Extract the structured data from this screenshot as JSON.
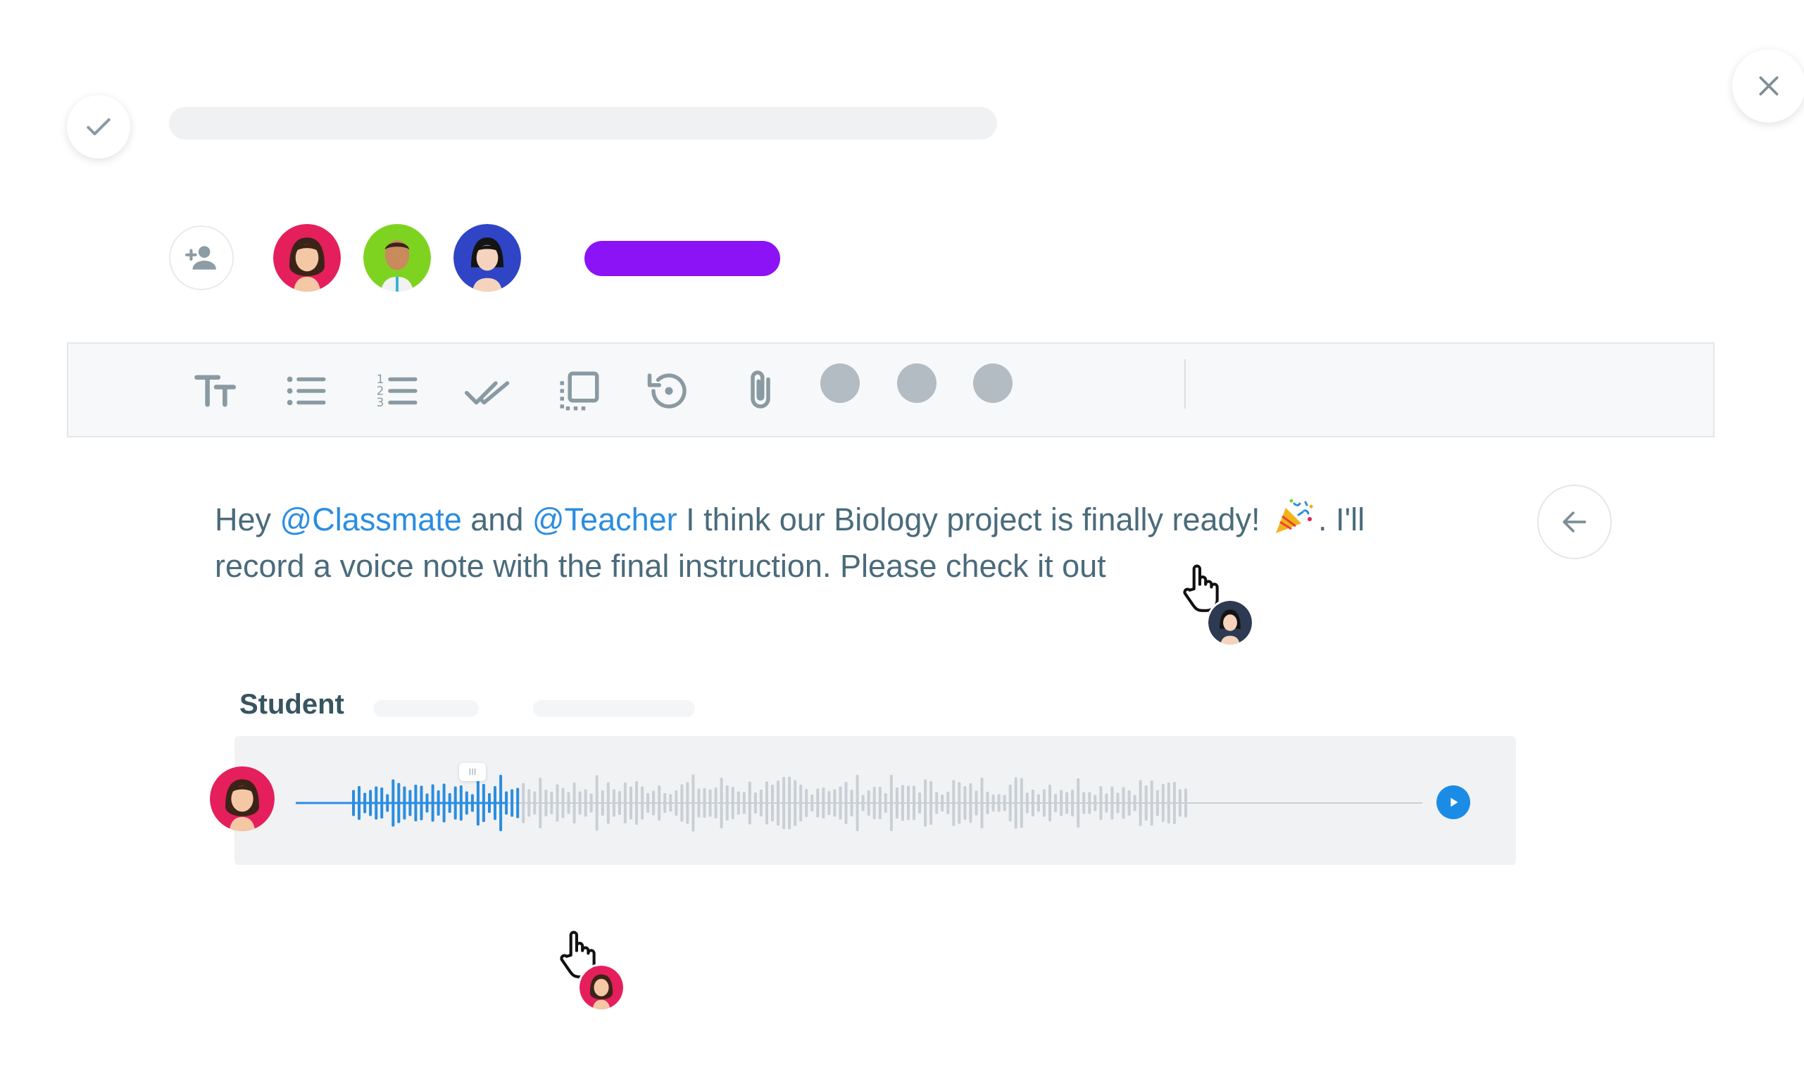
{
  "header": {
    "complete_icon": "check-icon",
    "close_icon": "close-icon"
  },
  "members": {
    "add_icon": "add-person-icon",
    "avatars": [
      "avatar-girl-brown-hair",
      "avatar-boy",
      "avatar-girl-black-hair"
    ]
  },
  "toolbar": {
    "items": [
      "text-size-icon",
      "bullet-list-icon",
      "numbered-list-icon",
      "checklist-icon",
      "copy-icon",
      "history-icon",
      "attachment-icon"
    ],
    "dots": 3
  },
  "message": {
    "part1": "Hey ",
    "mention1": "@Classmate",
    "part2": " and ",
    "mention2": "@Teacher",
    "part3": " I think our Biology project is finally ready! ",
    "emoji": "party-popper-icon",
    "part4": ". I'll record a voice note with the final instruction. Please check it out"
  },
  "voice_note": {
    "author": "Student",
    "progress": 0.2,
    "play_icon": "play-icon",
    "handle_label": "III"
  },
  "colors": {
    "accent_blue": "#2b8de0",
    "accent_purple": "#8b13f5",
    "wave_inactive": "#c9cfd4",
    "text": "#4a6b7b"
  }
}
